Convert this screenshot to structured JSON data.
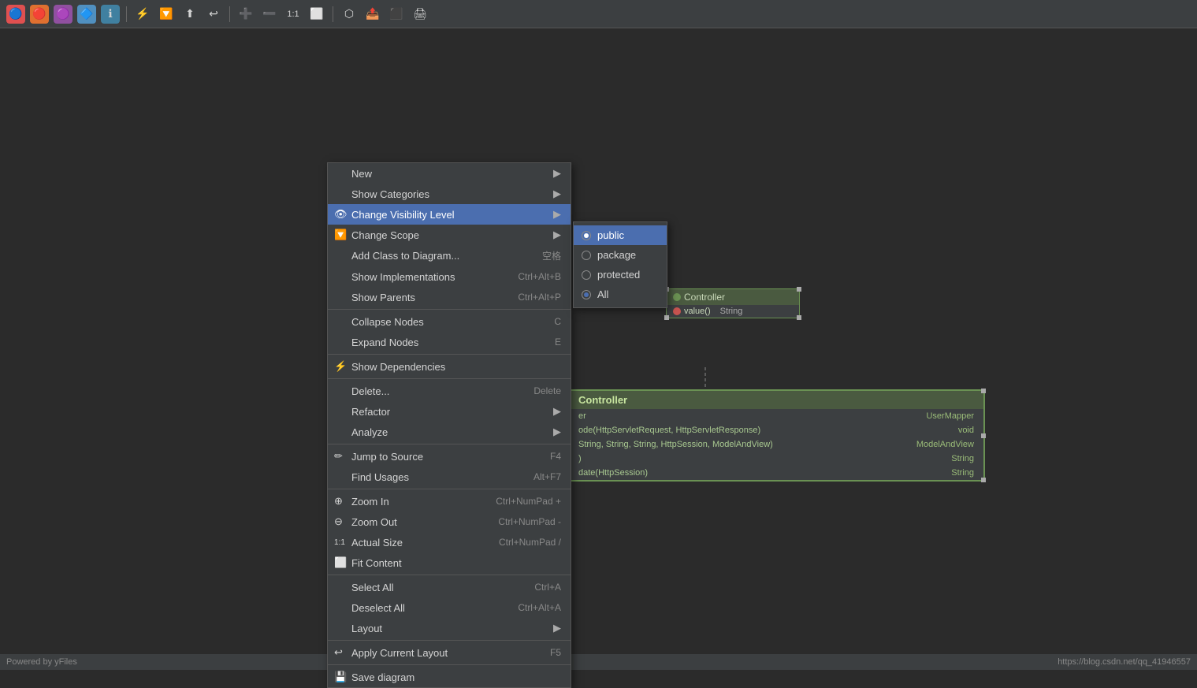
{
  "toolbar": {
    "icons": [
      "🔵",
      "🔴",
      "🟣",
      "🔷",
      "ℹ",
      "⚡",
      "🔽",
      "⬆",
      "↩",
      "➕",
      "➖",
      "1:1",
      "⬜",
      "⬡",
      "📤",
      "⬛",
      "🖨"
    ]
  },
  "context_menu": {
    "items": [
      {
        "id": "new",
        "label": "New",
        "shortcut": "",
        "arrow": true,
        "icon": "",
        "separator_after": false
      },
      {
        "id": "show-categories",
        "label": "Show Categories",
        "shortcut": "",
        "arrow": true,
        "icon": "",
        "separator_after": false
      },
      {
        "id": "change-visibility",
        "label": "Change Visibility Level",
        "shortcut": "",
        "arrow": true,
        "icon": "👁",
        "active": true,
        "separator_after": false
      },
      {
        "id": "change-scope",
        "label": "Change Scope",
        "shortcut": "",
        "arrow": true,
        "icon": "🔽",
        "separator_after": false
      },
      {
        "id": "add-class",
        "label": "Add Class to Diagram...",
        "shortcut": "空格",
        "arrow": false,
        "icon": "",
        "separator_after": false
      },
      {
        "id": "show-implementations",
        "label": "Show Implementations",
        "shortcut": "Ctrl+Alt+B",
        "arrow": false,
        "icon": "",
        "separator_after": false
      },
      {
        "id": "show-parents",
        "label": "Show Parents",
        "shortcut": "Ctrl+Alt+P",
        "arrow": false,
        "icon": "",
        "separator_after": true
      },
      {
        "id": "collapse-nodes",
        "label": "Collapse Nodes",
        "shortcut": "C",
        "arrow": false,
        "icon": "",
        "separator_after": false
      },
      {
        "id": "expand-nodes",
        "label": "Expand Nodes",
        "shortcut": "E",
        "arrow": false,
        "icon": "",
        "separator_after": true
      },
      {
        "id": "show-dependencies",
        "label": "Show Dependencies",
        "shortcut": "",
        "arrow": false,
        "icon": "⚡",
        "separator_after": true
      },
      {
        "id": "delete",
        "label": "Delete...",
        "shortcut": "Delete",
        "arrow": false,
        "icon": "",
        "separator_after": false
      },
      {
        "id": "refactor",
        "label": "Refactor",
        "shortcut": "",
        "arrow": true,
        "icon": "",
        "separator_after": false
      },
      {
        "id": "analyze",
        "label": "Analyze",
        "shortcut": "",
        "arrow": true,
        "icon": "",
        "separator_after": true
      },
      {
        "id": "jump-to-source",
        "label": "Jump to Source",
        "shortcut": "F4",
        "arrow": false,
        "icon": "✏",
        "separator_after": false
      },
      {
        "id": "find-usages",
        "label": "Find Usages",
        "shortcut": "Alt+F7",
        "arrow": false,
        "icon": "",
        "separator_after": true
      },
      {
        "id": "zoom-in",
        "label": "Zoom In",
        "shortcut": "Ctrl+NumPad +",
        "arrow": false,
        "icon": "➕",
        "separator_after": false
      },
      {
        "id": "zoom-out",
        "label": "Zoom Out",
        "shortcut": "Ctrl+NumPad -",
        "arrow": false,
        "icon": "➖",
        "separator_after": false
      },
      {
        "id": "actual-size",
        "label": "Actual Size",
        "shortcut": "Ctrl+NumPad /",
        "arrow": false,
        "icon": "1:1",
        "separator_after": false
      },
      {
        "id": "fit-content",
        "label": "Fit Content",
        "shortcut": "",
        "arrow": false,
        "icon": "⬜",
        "separator_after": true
      },
      {
        "id": "select-all",
        "label": "Select All",
        "shortcut": "Ctrl+A",
        "arrow": false,
        "icon": "",
        "separator_after": false
      },
      {
        "id": "deselect-all",
        "label": "Deselect All",
        "shortcut": "Ctrl+Alt+A",
        "arrow": false,
        "icon": "",
        "separator_after": false
      },
      {
        "id": "layout",
        "label": "Layout",
        "shortcut": "",
        "arrow": true,
        "icon": "",
        "separator_after": true
      },
      {
        "id": "apply-layout",
        "label": "Apply Current Layout",
        "shortcut": "F5",
        "arrow": false,
        "icon": "↩",
        "separator_after": true
      },
      {
        "id": "save-diagram",
        "label": "Save diagram",
        "shortcut": "",
        "arrow": false,
        "icon": "💾",
        "separator_after": false
      }
    ]
  },
  "submenu_visibility": {
    "items": [
      {
        "id": "public",
        "label": "public",
        "selected": true
      },
      {
        "id": "package",
        "label": "package",
        "selected": false
      },
      {
        "id": "protected",
        "label": "protected",
        "selected": false
      },
      {
        "id": "all",
        "label": "All",
        "selected": false,
        "radio_filled": true
      }
    ]
  },
  "small_node": {
    "title": "Controller",
    "rows": [
      {
        "label": "value()",
        "type": "String"
      }
    ]
  },
  "large_node": {
    "title": "Controller",
    "rows": [
      {
        "left": "er",
        "right": "UserMapper"
      },
      {
        "left": "ode(HttpServletRequest, HttpServletResponse)",
        "right": "void"
      },
      {
        "left": "String, String, String, HttpSession, ModelAndView)",
        "right": "ModelAndView"
      },
      {
        "left": ")",
        "right": "String"
      },
      {
        "left": "date(HttpSession)",
        "right": "String"
      }
    ]
  },
  "statusbar": {
    "left": "Powered by yFiles",
    "right": "https://blog.csdn.net/qq_41946557"
  }
}
